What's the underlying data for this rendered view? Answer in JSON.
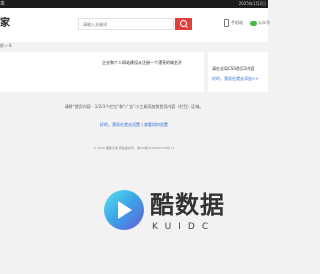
{
  "topbar": {
    "left_text": "本",
    "right_text": "2025年1月2日"
  },
  "header": {
    "logo_text": "家",
    "search_placeholder": "请输入关键词",
    "mobile_label": "手机站",
    "wechat_label": "公众号"
  },
  "breadcrumb": {
    "text": "前 » 8"
  },
  "ad_main": {
    "text": "企业和个人网站建设从注册一个漂亮的域名开"
  },
  "ad_side": {
    "title": "请在全局CSS首页2内容",
    "link": "好的，我现在就去添加>>"
  },
  "notice": {
    "text": "请将“首页内容 - 1/2/3个栏位”和“广告”小工具添加到首页内容（栏目）区域。",
    "link1": "好的，我现在就去设置",
    "separator": " | ",
    "link2": "查看如何设置"
  },
  "footer": {
    "copyright": "© 2025 酷数文库 网站备案号：湘ICP备2023000700号-11"
  },
  "brand": {
    "name": "酷数据",
    "sub": "KUIDC"
  }
}
